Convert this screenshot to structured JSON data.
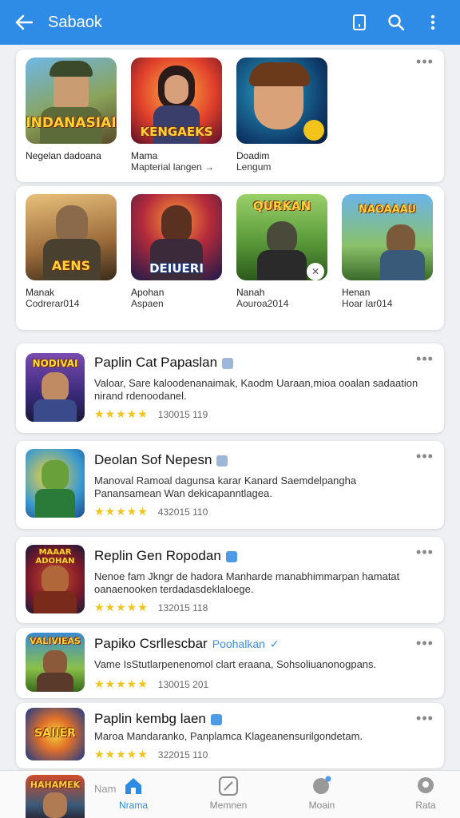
{
  "appbar": {
    "title": "Sabaok"
  },
  "row1": {
    "tiles": [
      {
        "art_text": "INDANASIAI",
        "name": "Negelan dadoana",
        "sub": ""
      },
      {
        "art_text": "KENGAEKS",
        "name": "Mama",
        "sub": "Mapterial langen →"
      },
      {
        "art_text": "",
        "name": "Doadim",
        "sub": "Lengum"
      }
    ]
  },
  "row2": {
    "tiles": [
      {
        "art_text": "AENS",
        "name": "Manak",
        "sub": "Codrerar014"
      },
      {
        "art_text": "DEIUERI",
        "name": "Apohan",
        "sub": "Aspaen"
      },
      {
        "art_text": "QURKAN",
        "name": "Nanah",
        "sub": "Aouroa2014"
      },
      {
        "art_text": "NAOAAAU",
        "name": "Henan",
        "sub": "Hoar Iar014"
      }
    ]
  },
  "list": [
    {
      "art_text": "NODIVAI",
      "title": "Paplin Cat Papaslan",
      "desc": "Valoar, Sare kaloodenanaimak, Kaodm Uaraan,mioa ooalan sadaation nirand rdenoodanel.",
      "count": "130015 119",
      "stars": "★★★★★",
      "publisher": ""
    },
    {
      "art_text": "",
      "title": "Deolan Sof Nepesn",
      "desc": "Manoval Ramoal dagunsa karar Kanard Saemdelpangha Panansamean Wan dekicapanntlagea.",
      "count": "432015 110",
      "stars": "★★★★★",
      "publisher": ""
    },
    {
      "art_text": "MAAAR ADOHAN",
      "title": "Replin Gen Ropodan",
      "desc": "Nenoe fam Jkngr de hadora Manharde manabhimmarpan hamatat oanaenooken terdadasdeklaloege.",
      "count": "132015 118",
      "stars": "★★★★★",
      "publisher": ""
    },
    {
      "art_text": "VALIVIEAS",
      "title": "Papiko Csrllescbar",
      "desc": "Vame IsStutlarpenenomol clart eraana, Sohsoliuanonogpans.",
      "count": "130015 201",
      "stars": "★★★★★",
      "publisher": "Poohalkan"
    },
    {
      "art_text": "SAIIER",
      "title": "Paplin kembg laen",
      "desc": "Maroa Mandaranko, Panplamca Klageanensurilgondetam.",
      "count": "322015 110",
      "stars": "★★★★★",
      "publisher": ""
    }
  ],
  "peek": {
    "art_text": "HAHAMEK",
    "label": "Nam"
  },
  "bottomnav": {
    "items": [
      {
        "label": "Nrama"
      },
      {
        "label": "Memnen"
      },
      {
        "label": "Moain"
      },
      {
        "label": "Rata"
      }
    ]
  },
  "colors": {
    "primary": "#2f8ce6",
    "star": "#f2c31a"
  }
}
